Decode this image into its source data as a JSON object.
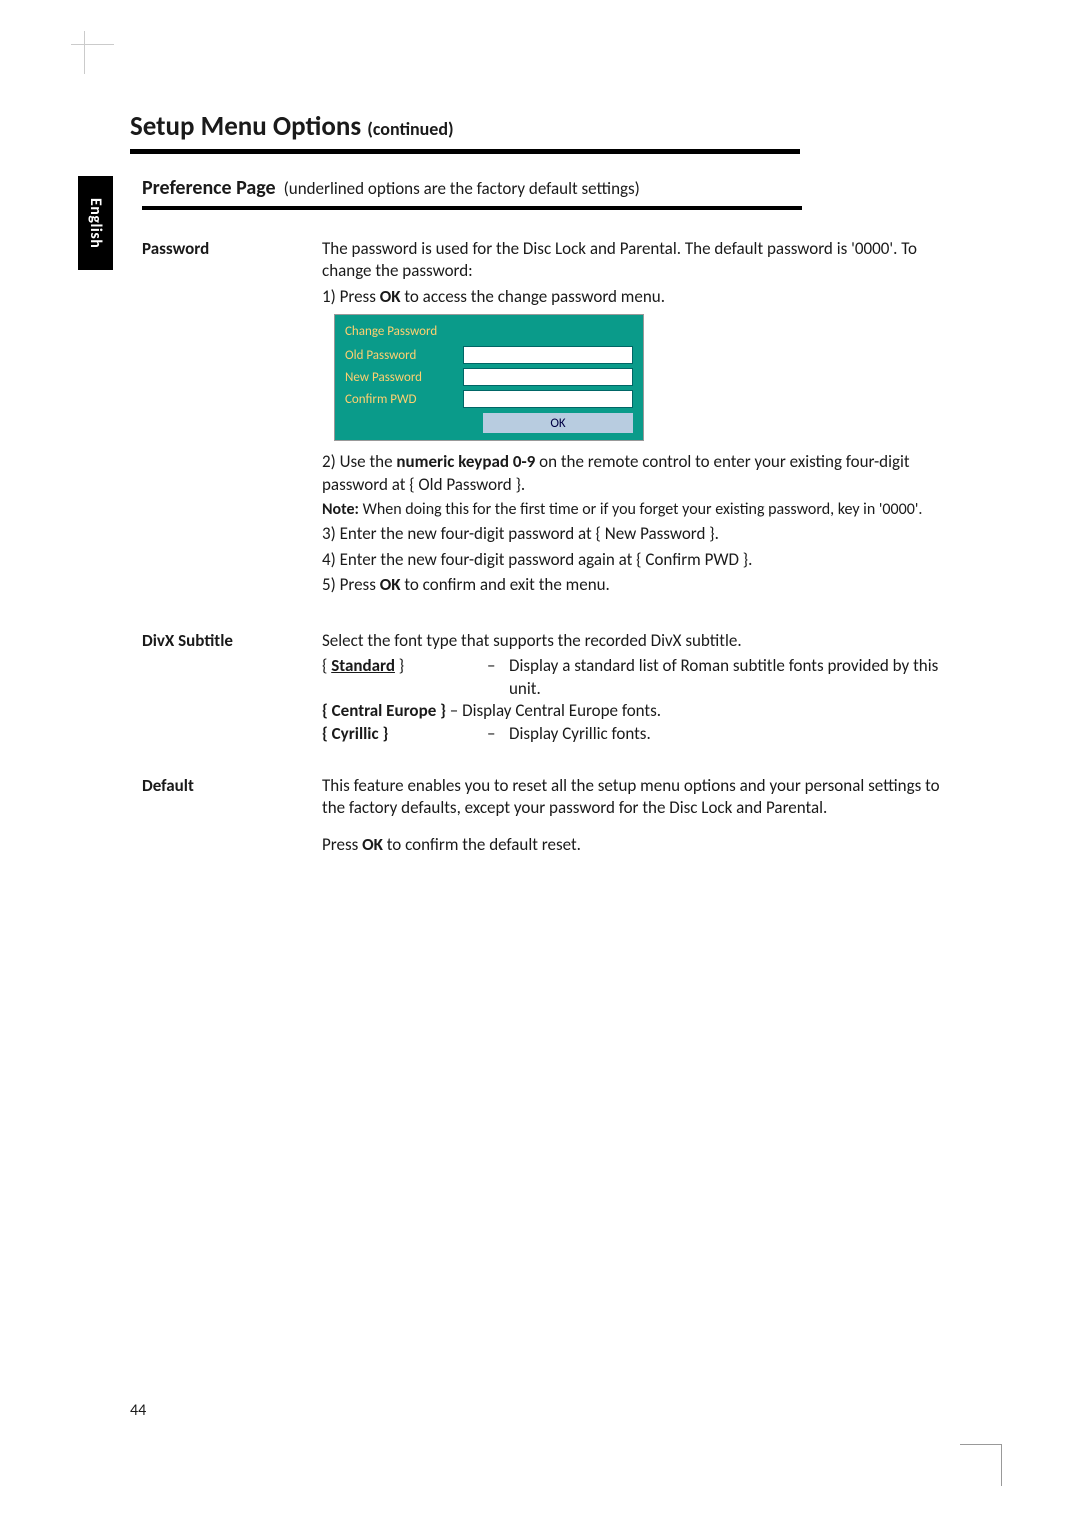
{
  "language_tab": "English",
  "page_title": "Setup Menu Options",
  "page_title_suffix": "(continued)",
  "pref_heading": "Preference Page",
  "pref_paren": "(underlined options are the factory default settings)",
  "page_number": "44",
  "password": {
    "label": "Password",
    "intro": "The password is used for the Disc Lock and Parental. The default password is '0000'.  To change the password:",
    "step1_prefix": "1)  Press ",
    "step1_bold": "OK",
    "step1_suffix": " to access the change password menu.",
    "dialog": {
      "title": "Change Password",
      "old": "Old Password",
      "new": "New Password",
      "confirm": "Confirm PWD",
      "ok": "OK"
    },
    "step2_prefix": "2)  Use the ",
    "step2_bold": "numeric keypad 0-9",
    "step2_suffix": " on the remote control to enter your existing four-digit password at { Old Password }.",
    "note_bold": "Note:",
    "note_text": "  When doing this for the first time or if you forget your existing password, key in '0000'.",
    "step3": "3)  Enter the new four-digit password at { New Password }.",
    "step4": "4)  Enter the new four-digit password again at { Confirm PWD }.",
    "step5_prefix": "5)  Press ",
    "step5_bold": "OK",
    "step5_suffix": " to confirm and exit the menu."
  },
  "divx": {
    "label": "DivX Subtitle",
    "intro": "Select the font type that supports the recorded DivX subtitle.",
    "opt1_label_pre": "{ ",
    "opt1_label": "Standard",
    "opt1_label_post": " }",
    "opt1_desc": "Display a standard list of Roman subtitle fonts provided by this unit.",
    "opt2_label": "{ Central Europe }",
    "opt2_desc": "Display Central Europe fonts.",
    "opt3_label": "{ Cyrillic }",
    "opt3_desc": "Display Cyrillic fonts."
  },
  "default": {
    "label": "Default",
    "intro": "This feature enables you to reset all the setup menu options and your personal settings to the factory defaults, except your password for the Disc Lock and Parental.",
    "action_prefix": "Press ",
    "action_bold": "OK",
    "action_suffix": " to confirm the default reset."
  }
}
